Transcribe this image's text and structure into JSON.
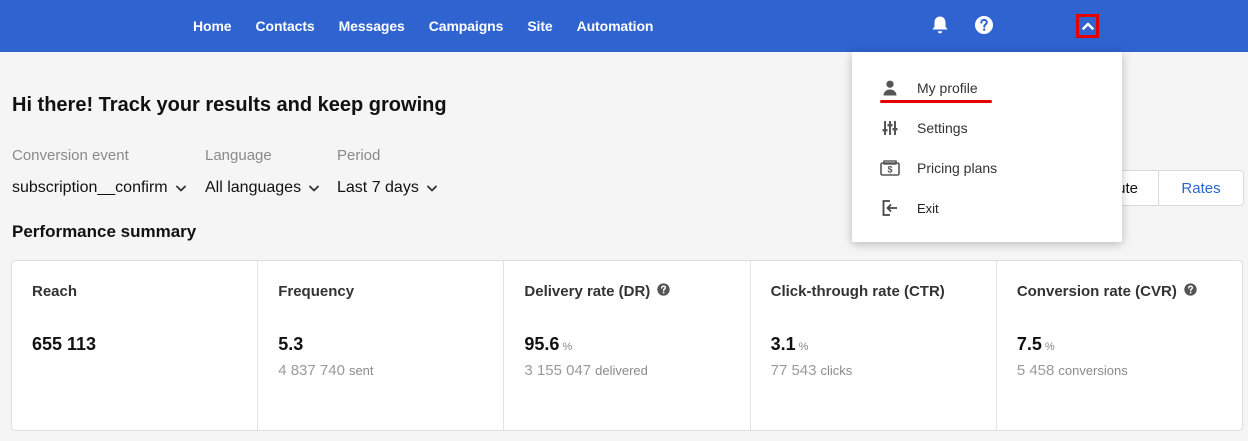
{
  "nav": {
    "items": [
      "Home",
      "Contacts",
      "Messages",
      "Campaigns",
      "Site",
      "Automation"
    ]
  },
  "icons": {
    "bell": "bell-icon",
    "help": "help-icon",
    "chevron": "chevron-up-icon"
  },
  "colors": {
    "brand": "#2f63d0",
    "highlight": "#e50000"
  },
  "main": {
    "greeting": "Hi there! Track your results and keep growing",
    "filters": [
      {
        "label": "Conversion event",
        "value": "subscription__confirm"
      },
      {
        "label": "Language",
        "value": "All languages"
      },
      {
        "label": "Period",
        "value": "Last 7 days"
      }
    ],
    "section_title": "Performance summary",
    "view_toggle": {
      "absolute": "ute",
      "rates": "Rates"
    }
  },
  "cards": [
    {
      "title": "Reach",
      "value": "655 113",
      "value_unit": "",
      "sub_value": "",
      "sub_unit": "",
      "help": false
    },
    {
      "title": "Frequency",
      "value": "5.3",
      "value_unit": "",
      "sub_value": "4 837 740",
      "sub_unit": "sent",
      "help": false
    },
    {
      "title": "Delivery rate (DR)",
      "value": "95.6",
      "value_unit": "%",
      "sub_value": "3 155 047",
      "sub_unit": "delivered",
      "help": true
    },
    {
      "title": "Click-through rate (CTR)",
      "value": "3.1",
      "value_unit": "%",
      "sub_value": "77 543",
      "sub_unit": "clicks",
      "help": false
    },
    {
      "title": "Conversion rate (CVR)",
      "value": "7.5",
      "value_unit": "%",
      "sub_value": "5 458",
      "sub_unit": "conversions",
      "help": true
    }
  ],
  "menu": {
    "items": [
      {
        "label": "My profile",
        "icon": "person-icon"
      },
      {
        "label": "Settings",
        "icon": "sliders-icon"
      },
      {
        "label": "Pricing plans",
        "icon": "pricing-icon"
      },
      {
        "label": "Exit",
        "icon": "exit-icon"
      }
    ]
  }
}
